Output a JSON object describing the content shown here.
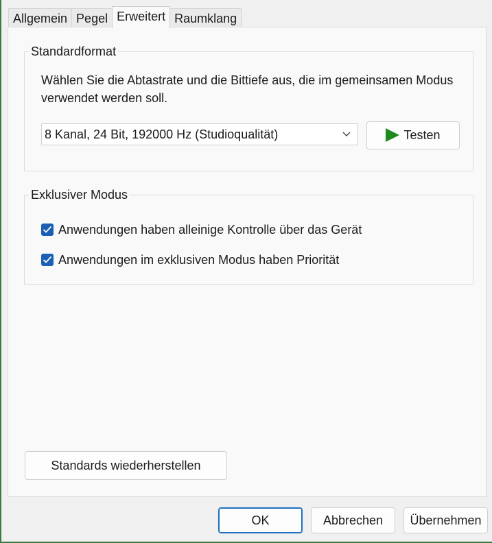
{
  "tabs": [
    {
      "label": "Allgemein",
      "active": false
    },
    {
      "label": "Pegel",
      "active": false
    },
    {
      "label": "Erweitert",
      "active": true
    },
    {
      "label": "Raumklang",
      "active": false
    }
  ],
  "default_format": {
    "title": "Standardformat",
    "description": "Wählen Sie die Abtastrate und die Bittiefe aus, die im gemeinsamen Modus verwendet werden soll.",
    "selected_format": "8 Kanal, 24 Bit, 192000 Hz (Studioqualität)",
    "test_button": "Testen"
  },
  "exclusive_mode": {
    "title": "Exklusiver Modus",
    "options": [
      {
        "label": "Anwendungen haben alleinige Kontrolle über das Gerät",
        "checked": true
      },
      {
        "label": "Anwendungen im exklusiven Modus haben Priorität",
        "checked": true
      }
    ]
  },
  "restore_defaults_button": "Standards wiederherstellen",
  "footer": {
    "ok": "OK",
    "cancel": "Abbrechen",
    "apply": "Übernehmen"
  },
  "colors": {
    "accent": "#1a5fb4",
    "play": "#1e8a1e",
    "window_edge": "#3d7a3d"
  },
  "icons": {
    "play": "play-icon",
    "dropdown": "chevron-down-icon",
    "check": "checkmark-icon"
  }
}
